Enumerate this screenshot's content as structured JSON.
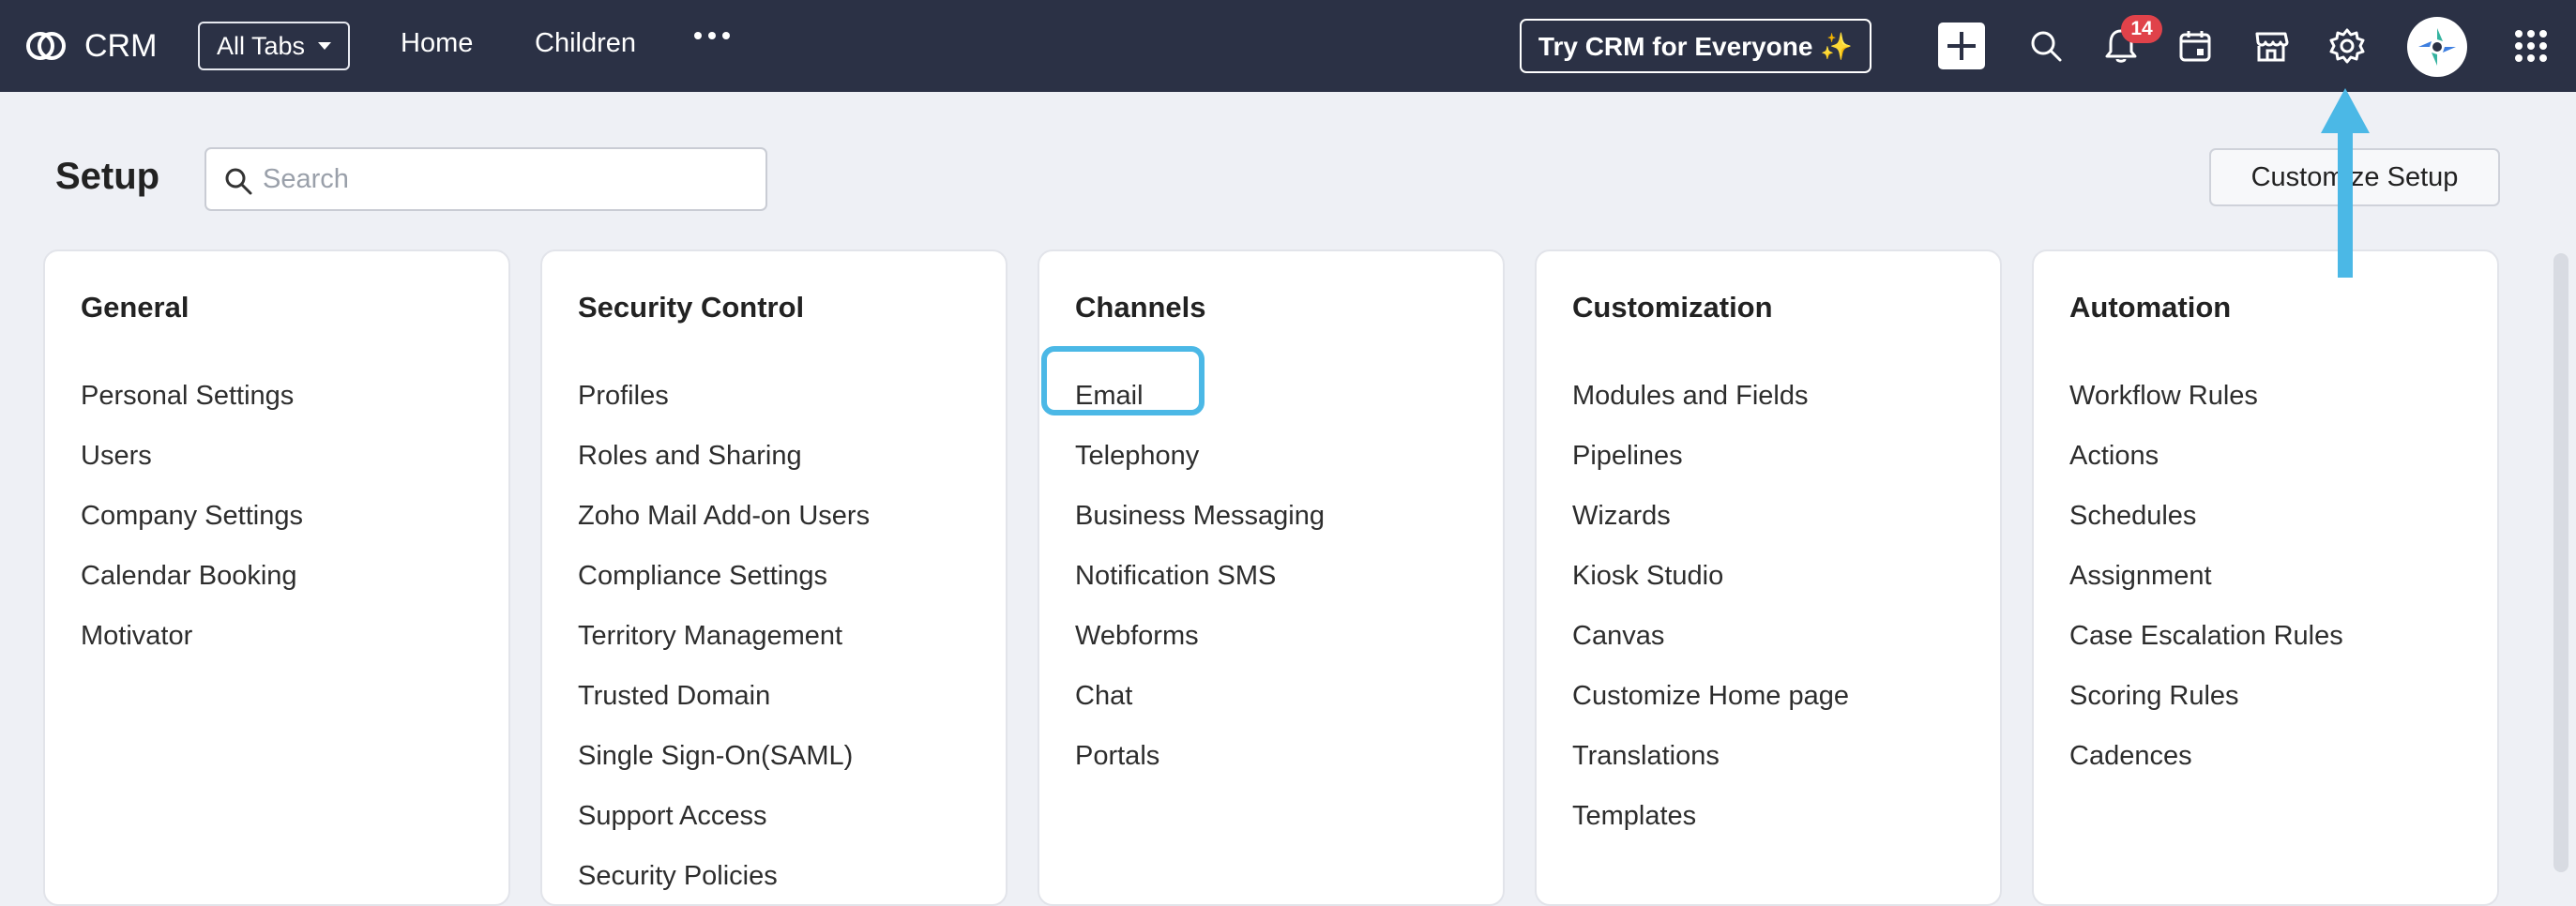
{
  "topbar": {
    "brand": "CRM",
    "all_tabs": "All Tabs",
    "nav": [
      "Home",
      "Children"
    ],
    "try_button": "Try CRM for Everyone ✨",
    "notifications_count": "14",
    "icons": [
      "crm-logo-icon",
      "caret-down-icon",
      "more-horizontal-icon",
      "plus-icon",
      "search-icon",
      "bell-icon",
      "calendar-icon",
      "store-icon",
      "gear-icon",
      "avatar-icon",
      "app-grid-icon"
    ]
  },
  "header": {
    "title": "Setup",
    "search_placeholder": "Search",
    "customize_button": "Customize Setup"
  },
  "cards": [
    {
      "title": "General",
      "items": [
        "Personal Settings",
        "Users",
        "Company Settings",
        "Calendar Booking",
        "Motivator"
      ]
    },
    {
      "title": "Security Control",
      "items": [
        "Profiles",
        "Roles and Sharing",
        "Zoho Mail Add-on Users",
        "Compliance Settings",
        "Territory Management",
        "Trusted Domain",
        "Single Sign-On(SAML)",
        "Support Access",
        "Security Policies"
      ]
    },
    {
      "title": "Channels",
      "items": [
        "Email",
        "Telephony",
        "Business Messaging",
        "Notification SMS",
        "Webforms",
        "Chat",
        "Portals"
      ]
    },
    {
      "title": "Customization",
      "items": [
        "Modules and Fields",
        "Pipelines",
        "Wizards",
        "Kiosk Studio",
        "Canvas",
        "Customize Home page",
        "Translations",
        "Templates"
      ]
    },
    {
      "title": "Automation",
      "items": [
        "Workflow Rules",
        "Actions",
        "Schedules",
        "Assignment",
        "Case Escalation Rules",
        "Scoring Rules",
        "Cadences"
      ]
    }
  ],
  "colors": {
    "topbar": "#2b3145",
    "highlight": "#4bb8e6",
    "badge": "#e0424a"
  }
}
